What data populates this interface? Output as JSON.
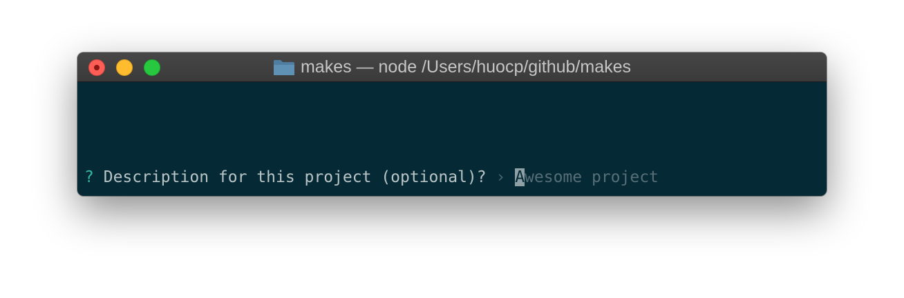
{
  "window": {
    "title": "makes — node /Users/huocp/github/makes",
    "icon": "folder-icon",
    "colors": {
      "background": "#052a35",
      "close": "#fd5f57",
      "minimize": "#febc2e",
      "maximize": "#27c840"
    }
  },
  "terminal": {
    "prompt": {
      "symbol": "?",
      "question": "Description for this project (optional)?",
      "arrow": "›",
      "cursor_char": "A",
      "placeholder_rest": "wesome project"
    }
  }
}
